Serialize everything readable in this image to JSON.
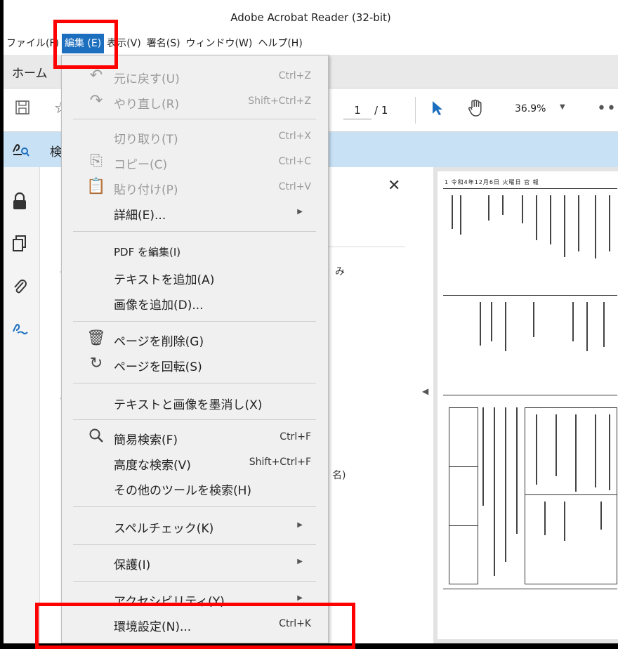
{
  "window": {
    "title": "Adobe Acrobat Reader (32-bit)"
  },
  "menubar": {
    "items": [
      {
        "label": "ファイル(F)"
      },
      {
        "label": "編集 (E)"
      },
      {
        "label": "表示(V)"
      },
      {
        "label": "署名(S)"
      },
      {
        "label": "ウィンドウ(W)"
      },
      {
        "label": "ヘルプ(H)"
      }
    ]
  },
  "tabs": {
    "home": "ホーム"
  },
  "toolbar": {
    "page_current": "1",
    "page_total": "/ 1",
    "zoom": "36.9%"
  },
  "tools_row": {
    "label": "検"
  },
  "panel": {
    "text_a": "み",
    "text_b": "名)"
  },
  "edit_menu": {
    "undo": {
      "label": "元に戻す(U)",
      "shortcut": "Ctrl+Z"
    },
    "redo": {
      "label": "やり直し(R)",
      "shortcut": "Shift+Ctrl+Z"
    },
    "cut": {
      "label": "切り取り(T)",
      "shortcut": "Ctrl+X"
    },
    "copy": {
      "label": "コピー(C)",
      "shortcut": "Ctrl+C"
    },
    "paste": {
      "label": "貼り付け(P)",
      "shortcut": "Ctrl+V"
    },
    "details": {
      "label": "詳細(E)..."
    },
    "edit_pdf": {
      "label": "PDF を編集(I)"
    },
    "add_text": {
      "label": "テキストを追加(A)"
    },
    "add_image": {
      "label": "画像を追加(D)..."
    },
    "delete_page": {
      "label": "ページを削除(G)"
    },
    "rotate_page": {
      "label": "ページを回転(S)"
    },
    "redact": {
      "label": "テキストと画像を墨消し(X)"
    },
    "find": {
      "label": "簡易検索(F)",
      "shortcut": "Ctrl+F"
    },
    "advanced_search": {
      "label": "高度な検索(V)",
      "shortcut": "Shift+Ctrl+F"
    },
    "search_tools": {
      "label": "その他のツールを検索(H)"
    },
    "spellcheck": {
      "label": "スペルチェック(K)"
    },
    "protection": {
      "label": "保護(I)"
    },
    "accessibility": {
      "label": "アクセシビリティ(Y)"
    },
    "preferences": {
      "label": "環境設定(N)...",
      "shortcut": "Ctrl+K"
    }
  },
  "document": {
    "header": "1 令和4年12月6日 火曜日 官 報"
  }
}
